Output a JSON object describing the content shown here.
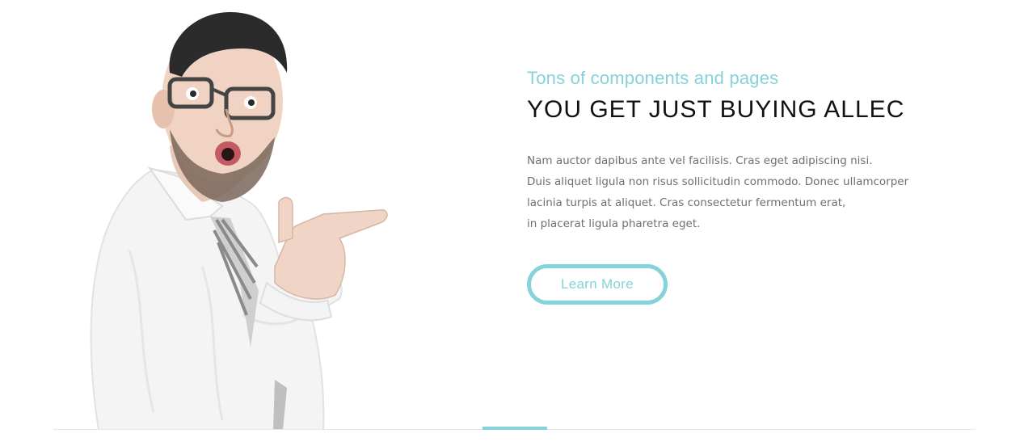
{
  "hero": {
    "subtitle": "Tons of components and pages",
    "title": "YOU GET JUST BUYING ALLEC",
    "body_lines": [
      "Nam auctor dapibus ante vel facilisis. Cras eget adipiscing nisi.",
      "Duis aliquet ligula non risus sollicitudin commodo. Donec ullamcorper",
      "lacinia turpis at aliquet. Cras consectetur fermentum erat,",
      "in placerat ligula pharetra eget."
    ],
    "cta_label": "Learn More",
    "photo_icon": "surprised-man-pointing-photo"
  },
  "colors": {
    "accent": "#86d2db",
    "heading": "#111111",
    "body": "#6f6f6f",
    "divider": "#e6e6e6"
  }
}
